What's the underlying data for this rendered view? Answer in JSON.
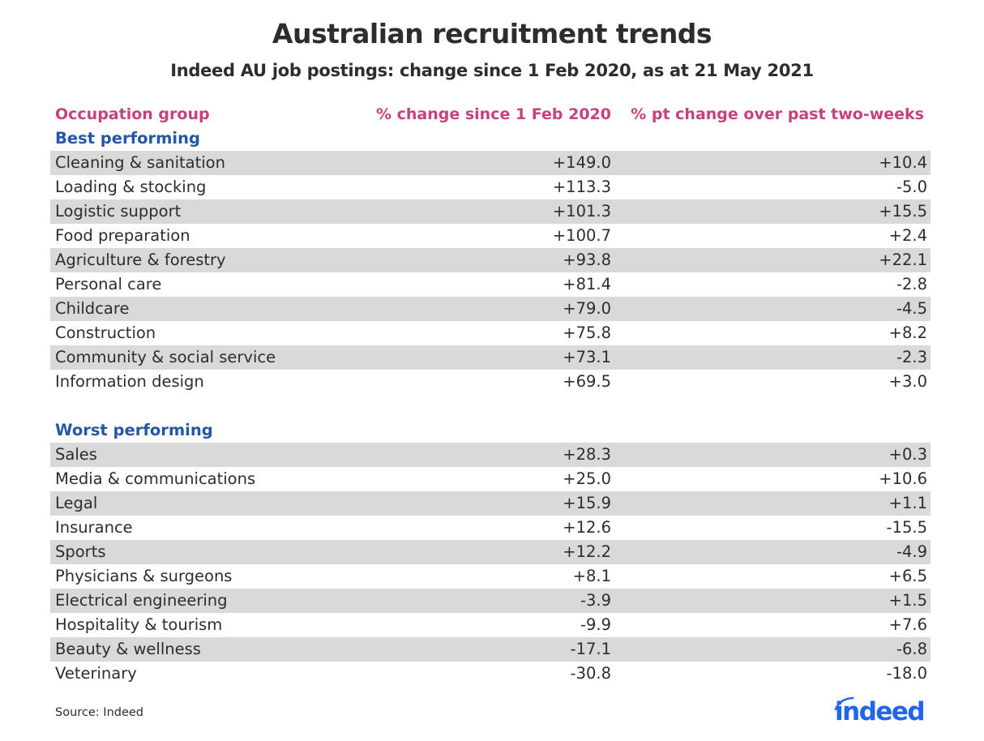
{
  "chart_data": {
    "type": "table",
    "title": "Australian recruitment trends",
    "subtitle": "Indeed AU job postings: change since 1 Feb 2020, as at 21 May 2021",
    "columns": [
      "Occupation group",
      "% change since 1 Feb 2020",
      "% pt change over past two-weeks"
    ],
    "sections": [
      {
        "label": "Best performing",
        "rows": [
          {
            "name": "Cleaning & sanitation",
            "change_since_feb2020": "+149.0",
            "pt_change_two_weeks": "+10.4"
          },
          {
            "name": "Loading & stocking",
            "change_since_feb2020": "+113.3",
            "pt_change_two_weeks": "-5.0"
          },
          {
            "name": "Logistic support",
            "change_since_feb2020": "+101.3",
            "pt_change_two_weeks": "+15.5"
          },
          {
            "name": "Food preparation",
            "change_since_feb2020": "+100.7",
            "pt_change_two_weeks": "+2.4"
          },
          {
            "name": "Agriculture & forestry",
            "change_since_feb2020": "+93.8",
            "pt_change_two_weeks": "+22.1"
          },
          {
            "name": "Personal care",
            "change_since_feb2020": "+81.4",
            "pt_change_two_weeks": "-2.8"
          },
          {
            "name": "Childcare",
            "change_since_feb2020": "+79.0",
            "pt_change_two_weeks": "-4.5"
          },
          {
            "name": "Construction",
            "change_since_feb2020": "+75.8",
            "pt_change_two_weeks": "+8.2"
          },
          {
            "name": "Community & social service",
            "change_since_feb2020": "+73.1",
            "pt_change_two_weeks": "-2.3"
          },
          {
            "name": "Information design",
            "change_since_feb2020": "+69.5",
            "pt_change_two_weeks": "+3.0"
          }
        ]
      },
      {
        "label": "Worst performing",
        "rows": [
          {
            "name": "Sales",
            "change_since_feb2020": "+28.3",
            "pt_change_two_weeks": "+0.3"
          },
          {
            "name": "Media & communications",
            "change_since_feb2020": "+25.0",
            "pt_change_two_weeks": "+10.6"
          },
          {
            "name": "Legal",
            "change_since_feb2020": "+15.9",
            "pt_change_two_weeks": "+1.1"
          },
          {
            "name": "Insurance",
            "change_since_feb2020": "+12.6",
            "pt_change_two_weeks": "-15.5"
          },
          {
            "name": "Sports",
            "change_since_feb2020": "+12.2",
            "pt_change_two_weeks": "-4.9"
          },
          {
            "name": "Physicians & surgeons",
            "change_since_feb2020": "+8.1",
            "pt_change_two_weeks": "+6.5"
          },
          {
            "name": "Electrical engineering",
            "change_since_feb2020": "-3.9",
            "pt_change_two_weeks": "+1.5"
          },
          {
            "name": "Hospitality & tourism",
            "change_since_feb2020": "-9.9",
            "pt_change_two_weeks": "+7.6"
          },
          {
            "name": "Beauty & wellness",
            "change_since_feb2020": "-17.1",
            "pt_change_two_weeks": "-6.8"
          },
          {
            "name": "Veterinary",
            "change_since_feb2020": "-30.8",
            "pt_change_two_weeks": "-18.0"
          }
        ]
      }
    ],
    "source": "Source: Indeed",
    "colors": {
      "header": "#c6427f",
      "section": "#2557a7",
      "row_shade": "#d9d9d9",
      "text": "#2d2d2d",
      "logo": "#2164f3"
    }
  },
  "logo": {
    "text": "indeed"
  }
}
